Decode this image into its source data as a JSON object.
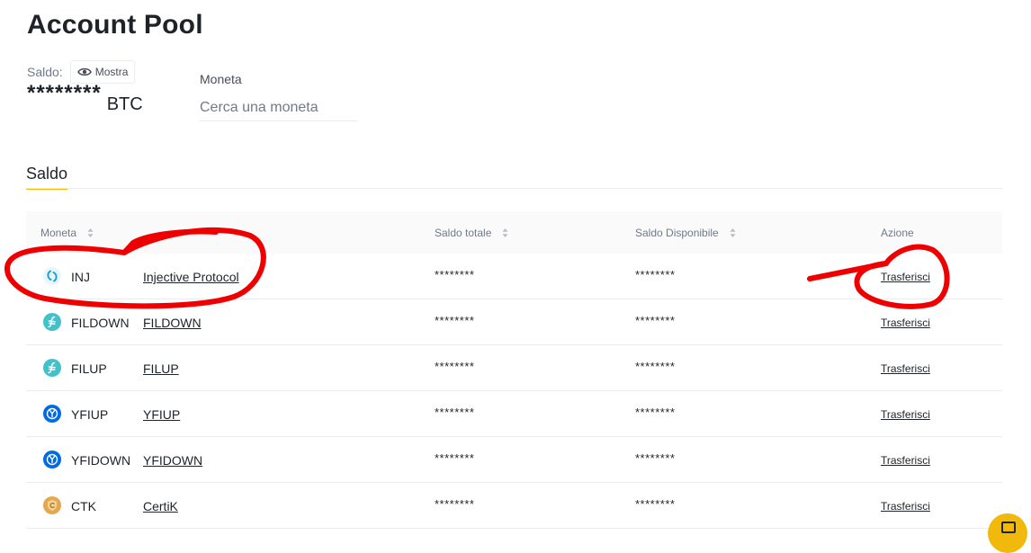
{
  "page": {
    "title": "Account Pool"
  },
  "balance": {
    "label": "Saldo:",
    "show_button": "Mostra",
    "masked_value": "********",
    "unit": "BTC"
  },
  "search": {
    "label": "Moneta",
    "placeholder": "Cerca una moneta",
    "value": ""
  },
  "tabs": [
    {
      "label": "Saldo",
      "active": true
    }
  ],
  "table": {
    "headers": {
      "coin": "Moneta",
      "total": "Saldo totale",
      "available": "Saldo Disponibile",
      "action": "Azione"
    },
    "rows": [
      {
        "symbol": "INJ",
        "name": "Injective Protocol",
        "total": "********",
        "available": "********",
        "action": "Trasferisci",
        "icon": "injective-icon",
        "icon_color": "#16a3d9"
      },
      {
        "symbol": "FILDOWN",
        "name": "FILDOWN",
        "total": "********",
        "available": "********",
        "action": "Trasferisci",
        "icon": "filecoin-icon",
        "icon_color": "#42c1ca"
      },
      {
        "symbol": "FILUP",
        "name": "FILUP",
        "total": "********",
        "available": "********",
        "action": "Trasferisci",
        "icon": "filecoin-icon",
        "icon_color": "#42c1ca"
      },
      {
        "symbol": "YFIUP",
        "name": "YFIUP",
        "total": "********",
        "available": "********",
        "action": "Trasferisci",
        "icon": "yearn-icon",
        "icon_color": "#006ae3"
      },
      {
        "symbol": "YFIDOWN",
        "name": "YFIDOWN",
        "total": "********",
        "available": "********",
        "action": "Trasferisci",
        "icon": "yearn-icon",
        "icon_color": "#006ae3"
      },
      {
        "symbol": "CTK",
        "name": "CertiK",
        "total": "********",
        "available": "********",
        "action": "Trasferisci",
        "icon": "certik-icon",
        "icon_color": "#e4a84e"
      }
    ]
  },
  "colors": {
    "accent": "#f0b90b",
    "annotation": "#ee0000",
    "text": "#1e2329",
    "muted": "#707a8a"
  },
  "chat_button": {
    "icon": "chat-icon"
  }
}
